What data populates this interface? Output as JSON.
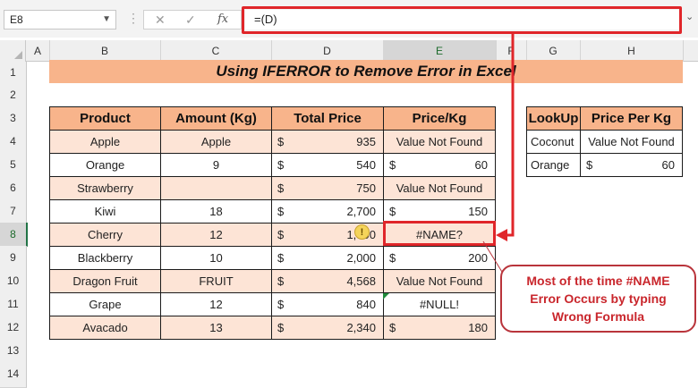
{
  "formula_bar": {
    "name_box": "E8",
    "cancel_symbol": "✕",
    "enter_symbol": "✓",
    "fx_label": "fx",
    "formula": "=(D)",
    "highlight_color": "#e0262a"
  },
  "columns": [
    "A",
    "B",
    "C",
    "D",
    "E",
    "F",
    "G",
    "H"
  ],
  "rows": [
    "1",
    "2",
    "3",
    "4",
    "5",
    "6",
    "7",
    "8",
    "9",
    "10",
    "11",
    "12",
    "13",
    "14"
  ],
  "selected_cell": "E8",
  "title": "Using IFERROR to Remove Error in Excel",
  "main_table": {
    "headers": [
      "Product",
      "Amount (Kg)",
      "Total Price",
      "Price/Kg"
    ],
    "rows": [
      {
        "product": "Apple",
        "amount": "Apple",
        "total_sym": "$",
        "total": "935",
        "price_sym": "",
        "price": "Value Not Found"
      },
      {
        "product": "Orange",
        "amount": "9",
        "total_sym": "$",
        "total": "540",
        "price_sym": "$",
        "price": "60"
      },
      {
        "product": "Strawberry",
        "amount": "",
        "total_sym": "$",
        "total": "750",
        "price_sym": "",
        "price": "Value Not Found"
      },
      {
        "product": "Kiwi",
        "amount": "18",
        "total_sym": "$",
        "total": "2,700",
        "price_sym": "$",
        "price": "150"
      },
      {
        "product": "Cherry",
        "amount": "12",
        "total_sym": "$",
        "total": "1,500",
        "price_sym": "",
        "price": "#NAME?"
      },
      {
        "product": "Blackberry",
        "amount": "10",
        "total_sym": "$",
        "total": "2,000",
        "price_sym": "$",
        "price": "200"
      },
      {
        "product": "Dragon Fruit",
        "amount": "FRUIT",
        "total_sym": "$",
        "total": "4,568",
        "price_sym": "",
        "price": "Value Not Found"
      },
      {
        "product": "Grape",
        "amount": "12",
        "total_sym": "$",
        "total": "840",
        "price_sym": "",
        "price": "#NULL!"
      },
      {
        "product": "Avacado",
        "amount": "13",
        "total_sym": "$",
        "total": "2,340",
        "price_sym": "$",
        "price": "180"
      }
    ]
  },
  "lookup_table": {
    "headers": [
      "LookUp",
      "Price Per Kg"
    ],
    "rows": [
      {
        "lookup": "Coconut",
        "price_sym": "",
        "price": "Value Not Found"
      },
      {
        "lookup": "Orange",
        "price_sym": "$",
        "price": "60"
      }
    ]
  },
  "warning_icon": "!",
  "callout": {
    "line1": "Most of the time #NAME",
    "line2": "Error Occurs by typing",
    "line3": "Wrong Formula",
    "color": "#c9262c"
  },
  "colors": {
    "header_fill": "#f8b48b",
    "band_fill": "#fde4d6",
    "accent_red": "#e0262a",
    "excel_green": "#217346"
  }
}
